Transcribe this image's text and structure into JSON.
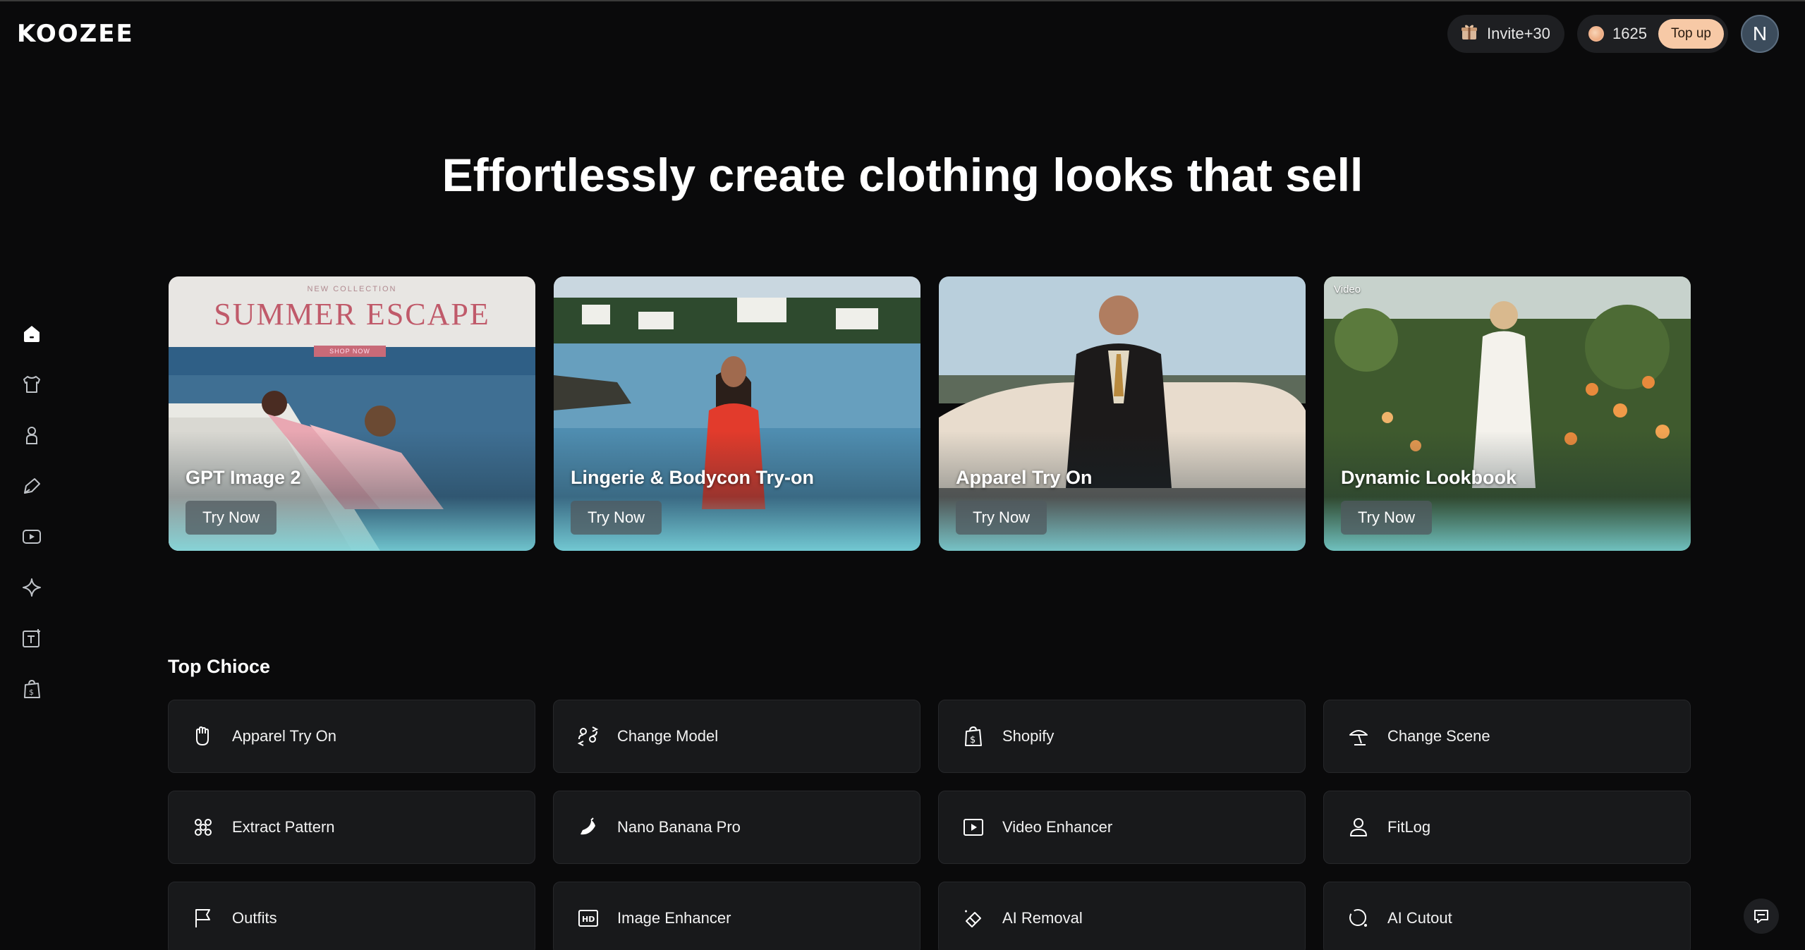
{
  "header": {
    "logo": "KOOZEE",
    "invite_label": "Invite+30",
    "credits": "1625",
    "topup_label": "Top up",
    "avatar_initial": "N"
  },
  "sidebar": {
    "items": [
      {
        "icon": "home-icon"
      },
      {
        "icon": "shirt-icon"
      },
      {
        "icon": "model-icon"
      },
      {
        "icon": "edit-icon"
      },
      {
        "icon": "video-icon"
      },
      {
        "icon": "sparkle-icon"
      },
      {
        "icon": "text-add-icon"
      },
      {
        "icon": "shopify-bag-icon"
      }
    ]
  },
  "hero": {
    "title": "Effortlessly create clothing looks that sell"
  },
  "cards": [
    {
      "title": "GPT Image 2",
      "button": "Try Now",
      "poster_small": "NEW COLLECTION",
      "poster_big": "SUMMER ESCAPE",
      "poster_btn": "SHOP NOW"
    },
    {
      "title": "Lingerie & Bodycon Try-on",
      "button": "Try Now"
    },
    {
      "title": "Apparel Try On",
      "button": "Try Now"
    },
    {
      "title": "Dynamic Lookbook",
      "button": "Try Now",
      "tag": "Video"
    }
  ],
  "top_choice": {
    "title": "Top Chioce",
    "tools": [
      {
        "label": "Apparel Try On",
        "icon": "hanger-hand-icon"
      },
      {
        "label": "Change Model",
        "icon": "swap-person-icon"
      },
      {
        "label": "Shopify",
        "icon": "shopify-icon"
      },
      {
        "label": "Change Scene",
        "icon": "scene-icon"
      },
      {
        "label": "Extract Pattern",
        "icon": "pattern-icon"
      },
      {
        "label": "Nano Banana Pro",
        "icon": "banana-icon"
      },
      {
        "label": "Video Enhancer",
        "icon": "video-play-icon"
      },
      {
        "label": "FitLog",
        "icon": "fitlog-icon"
      },
      {
        "label": "Outfits",
        "icon": "flag-icon"
      },
      {
        "label": "Image Enhancer",
        "icon": "hd-icon"
      },
      {
        "label": "AI Removal",
        "icon": "eraser-icon"
      },
      {
        "label": "AI Cutout",
        "icon": "cutout-icon"
      }
    ]
  },
  "colors": {
    "background": "#0a0a0b",
    "tile": "#18191b",
    "topup": "#f7c9a6"
  }
}
